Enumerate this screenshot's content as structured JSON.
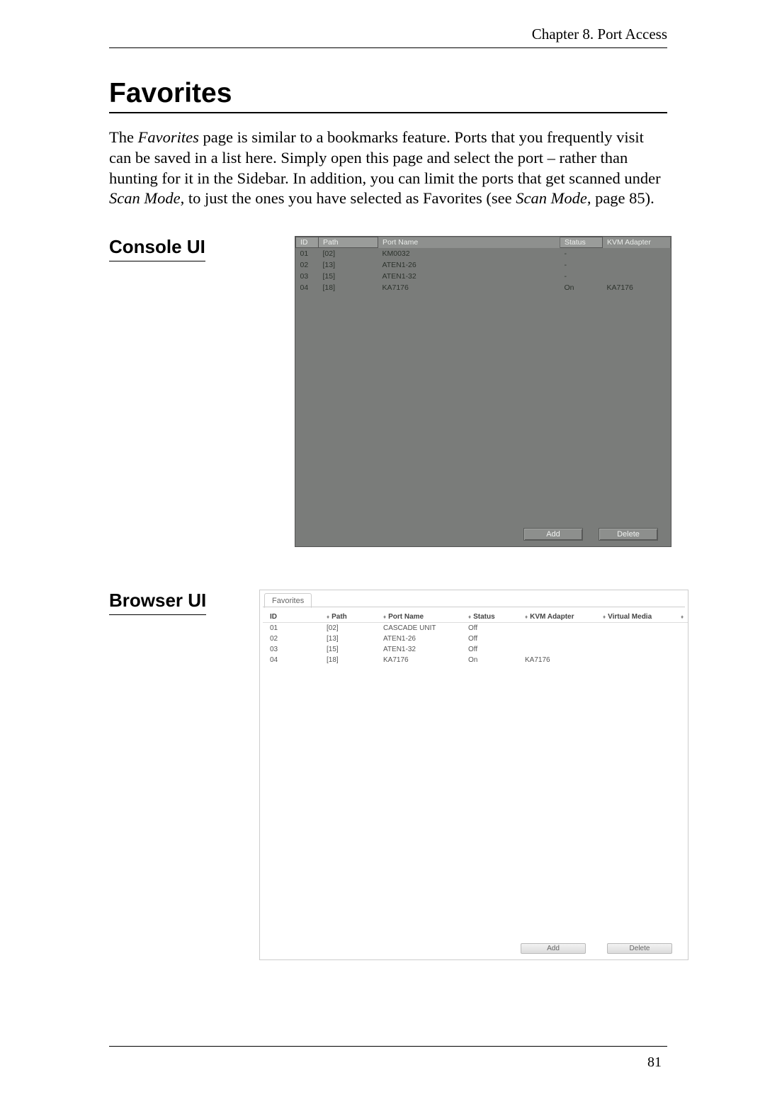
{
  "running_head": "Chapter 8. Port Access",
  "title": "Favorites",
  "intro": {
    "p1a": "The ",
    "p1b": "Favorites",
    "p1c": " page is similar to a bookmarks feature. Ports that you frequently visit can be saved in a list here. Simply open this page and select the port – rather than hunting for it in the Sidebar. In addition, you can limit the ports that get scanned under ",
    "p1d": "Scan Mode",
    "p1e": ", to just the ones you have selected as Favorites (see ",
    "p1f": "Scan Mode",
    "p1g": ", page 85)."
  },
  "section_console": "Console UI",
  "section_browser": "Browser UI",
  "console": {
    "columns": {
      "id": "ID",
      "path": "Path",
      "name": "Port Name",
      "status": "Status",
      "adapter": "KVM Adapter"
    },
    "rows": [
      {
        "id": "01",
        "path": "[02]",
        "name": "KM0032",
        "status": "-",
        "adapter": ""
      },
      {
        "id": "02",
        "path": "[13]",
        "name": "ATEN1-26",
        "status": "-",
        "adapter": ""
      },
      {
        "id": "03",
        "path": "[15]",
        "name": "ATEN1-32",
        "status": "-",
        "adapter": ""
      },
      {
        "id": "04",
        "path": "[18]",
        "name": "KA7176",
        "status": "On",
        "adapter": "KA7176"
      }
    ],
    "buttons": {
      "add": "Add",
      "delete": "Delete"
    }
  },
  "browser": {
    "tab": "Favorites",
    "columns": {
      "id": "ID",
      "path": "Path",
      "name": "Port Name",
      "status": "Status",
      "adapter": "KVM Adapter",
      "vm": "Virtual Media"
    },
    "rows": [
      {
        "id": "01",
        "path": "[02]",
        "name": "CASCADE UNIT",
        "status": "Off",
        "adapter": "",
        "vm": ""
      },
      {
        "id": "02",
        "path": "[13]",
        "name": "ATEN1-26",
        "status": "Off",
        "adapter": "",
        "vm": ""
      },
      {
        "id": "03",
        "path": "[15]",
        "name": "ATEN1-32",
        "status": "Off",
        "adapter": "",
        "vm": ""
      },
      {
        "id": "04",
        "path": "[18]",
        "name": "KA7176",
        "status": "On",
        "adapter": "KA7176",
        "vm": ""
      }
    ],
    "buttons": {
      "add": "Add",
      "delete": "Delete"
    }
  },
  "page_number": "81"
}
